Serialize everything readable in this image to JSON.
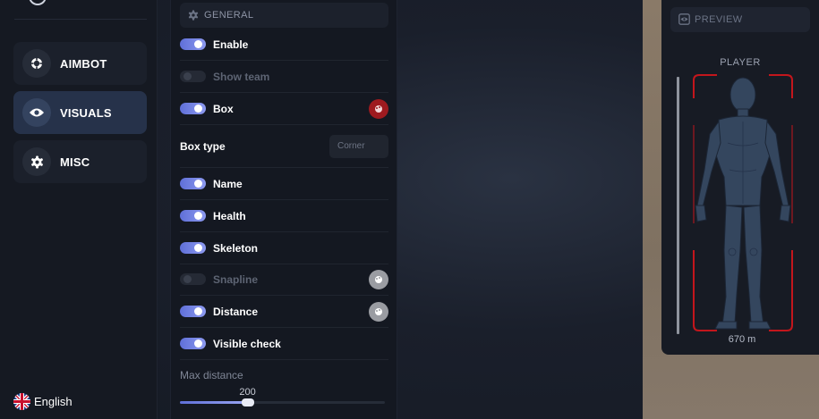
{
  "sidebar": {
    "items": [
      {
        "label": "AIMBOT",
        "icon": "crosshair-icon",
        "active": false
      },
      {
        "label": "VISUALS",
        "icon": "eye-icon",
        "active": true
      },
      {
        "label": "MISC",
        "icon": "gear-icon",
        "active": false
      }
    ],
    "language": "English"
  },
  "general": {
    "title": "GENERAL",
    "rows": {
      "enable": {
        "label": "Enable",
        "on": true
      },
      "show_team": {
        "label": "Show team",
        "on": false
      },
      "box": {
        "label": "Box",
        "on": true,
        "color": "#9e1a1f"
      },
      "box_type": {
        "label": "Box type",
        "value": "Corner"
      },
      "name": {
        "label": "Name",
        "on": true
      },
      "health": {
        "label": "Health",
        "on": true
      },
      "skeleton": {
        "label": "Skeleton",
        "on": true
      },
      "snapline": {
        "label": "Snapline",
        "on": false,
        "color": "#9a9ca2"
      },
      "distance": {
        "label": "Distance",
        "on": true,
        "color": "#9a9ca2"
      },
      "visible_check": {
        "label": "Visible check",
        "on": true
      }
    },
    "max_distance": {
      "label": "Max distance",
      "value": "200",
      "fraction": 0.33
    }
  },
  "preview": {
    "title": "PREVIEW",
    "player_label": "PLAYER",
    "distance": "670 m"
  },
  "colors": {
    "accent": "#6f7fe0",
    "box": "#c3161c"
  }
}
